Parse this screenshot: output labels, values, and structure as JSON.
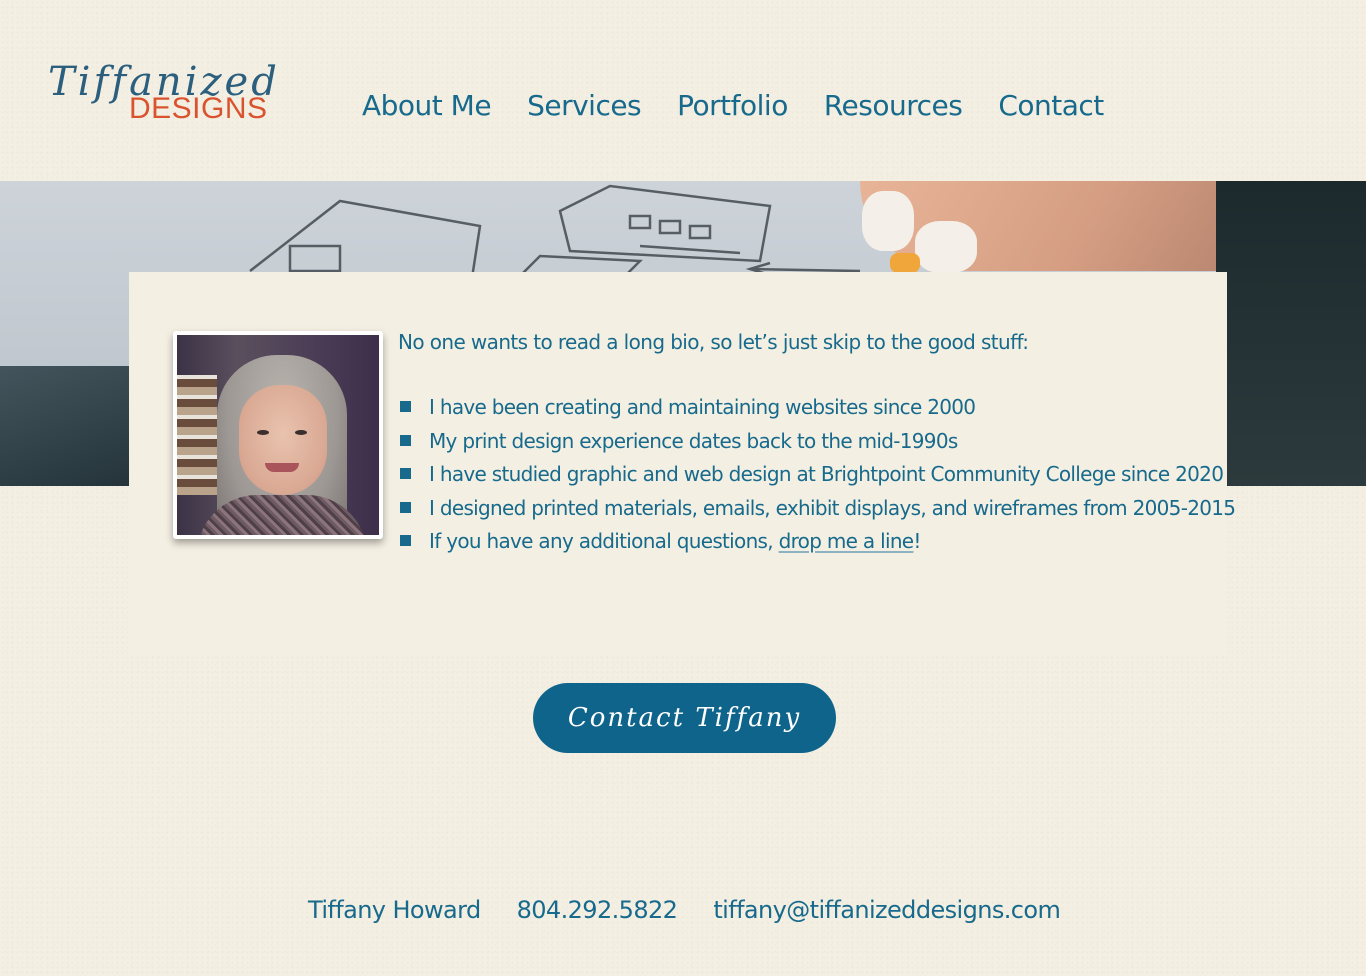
{
  "header": {
    "logo_script": "Tiffanized",
    "logo_sub": "DESIGNS",
    "nav": [
      {
        "label": "About Me"
      },
      {
        "label": "Services"
      },
      {
        "label": "Portfolio"
      },
      {
        "label": "Resources"
      },
      {
        "label": "Contact"
      }
    ]
  },
  "about": {
    "intro": "No one wants to read a long bio, so let’s just skip to the good stuff:",
    "bullets": [
      {
        "text": "I have been creating and maintaining websites since 2000"
      },
      {
        "text": "My print design experience dates back to the mid-1990s"
      },
      {
        "text": "I have studied graphic and web design at Brightpoint Community College since 2020"
      },
      {
        "text": "I designed printed materials, emails, exhibit displays, and wireframes from 2005-2015"
      },
      {
        "text": "If you have any additional questions, ",
        "link": "drop me a line",
        "suffix": "!"
      }
    ]
  },
  "cta": {
    "label": "Contact Tiffany"
  },
  "footer": {
    "name": "Tiffany Howard",
    "phone": "804.292.5822",
    "email": "tiffany@tiffanizeddesigns.com"
  },
  "colors": {
    "primary": "#176a8c",
    "accent": "#d9542e",
    "background": "#f4efe3",
    "button": "#0f648b"
  }
}
